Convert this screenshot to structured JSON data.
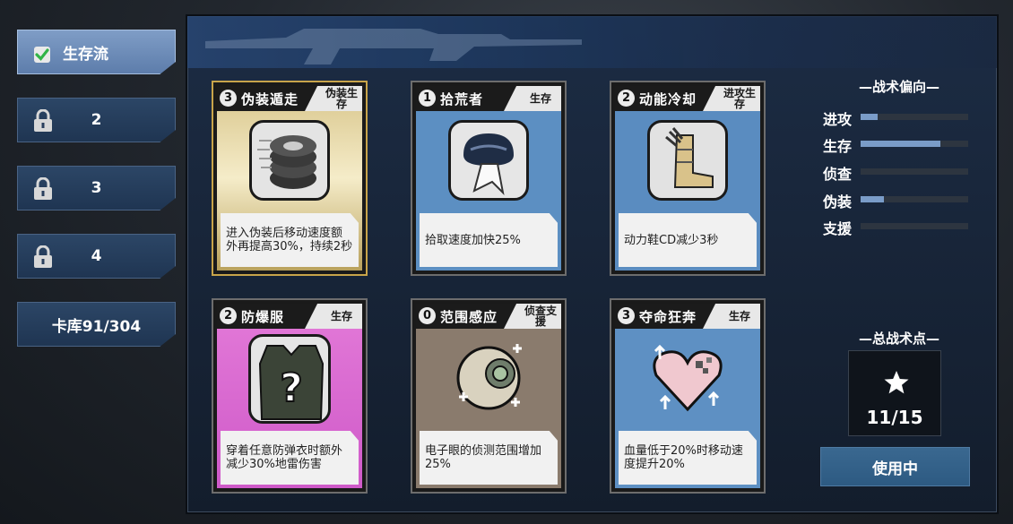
{
  "sidebar": {
    "tabs": [
      {
        "label": "生存流",
        "state": "active",
        "icon": "check-icon"
      },
      {
        "label": "2",
        "state": "locked",
        "icon": "lock-icon"
      },
      {
        "label": "3",
        "state": "locked",
        "icon": "lock-icon"
      },
      {
        "label": "4",
        "state": "locked",
        "icon": "lock-icon"
      },
      {
        "label": "卡库91/304",
        "state": "normal"
      }
    ]
  },
  "cards": [
    {
      "cost": "3",
      "name": "伪装遁走",
      "tag": "伪装生存",
      "desc": "进入伪装后移动速度额外再提高30%，持续2秒",
      "theme": "gold",
      "icon": "tires-icon"
    },
    {
      "cost": "1",
      "name": "拾荒者",
      "tag": "生存",
      "desc": "拾取速度加快25%",
      "theme": "blue",
      "icon": "sack-icon"
    },
    {
      "cost": "2",
      "name": "动能冷却",
      "tag": "进攻生存",
      "desc": "动力鞋CD减少3秒",
      "theme": "blue",
      "icon": "boot-icon"
    },
    {
      "cost": "2",
      "name": "防爆服",
      "tag": "生存",
      "desc": "穿着任意防弹衣时额外减少30%地雷伤害",
      "theme": "pink",
      "icon": "vest-icon"
    },
    {
      "cost": "0",
      "name": "范围感应",
      "tag": "侦查支援",
      "desc": "电子眼的侦测范围增加25%",
      "theme": "brown",
      "icon": "eye-orb-icon"
    },
    {
      "cost": "3",
      "name": "夺命狂奔",
      "tag": "生存",
      "desc": "血量低于20%时移动速度提升20%",
      "theme": "blue",
      "icon": "heart-icon"
    }
  ],
  "tendency": {
    "title": "—战术偏向—",
    "items": [
      {
        "label": "进攻",
        "level": 0.16
      },
      {
        "label": "生存",
        "level": 0.74
      },
      {
        "label": "侦查",
        "level": 0.0
      },
      {
        "label": "伪装",
        "level": 0.22
      },
      {
        "label": "支援",
        "level": 0.0
      }
    ]
  },
  "points": {
    "title": "—总战术点—",
    "value": "11/15",
    "icon": "star-icon"
  },
  "action": {
    "label": "使用中"
  }
}
